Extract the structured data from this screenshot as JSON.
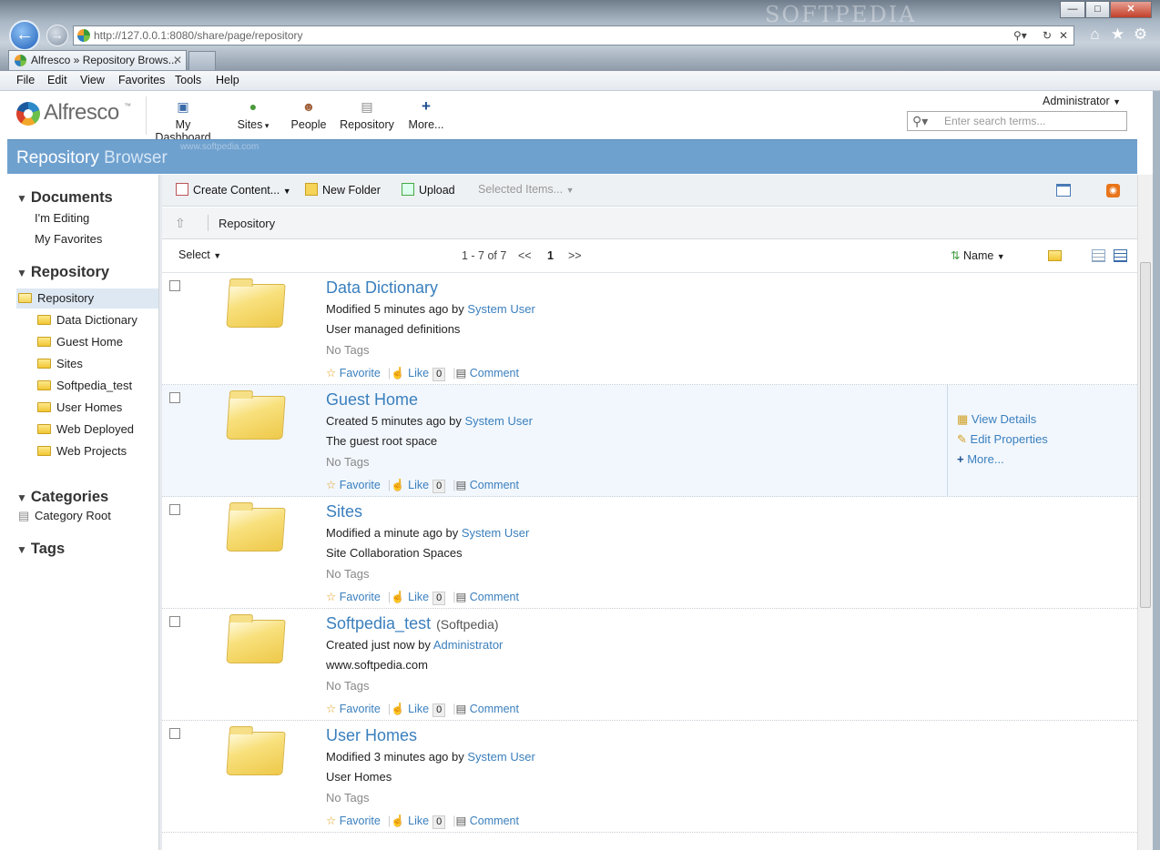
{
  "browser": {
    "watermark": "SOFTPEDIA",
    "address_host": "http://127.0.0.1",
    "address_path": ":8080/share/page/repository",
    "tab_title": "Alfresco » Repository Brows...",
    "menu": [
      "File",
      "Edit",
      "View",
      "Favorites",
      "Tools",
      "Help"
    ]
  },
  "app": {
    "logo": "Alfresco",
    "logo_tm": "™",
    "nav": [
      {
        "label": "My Dashboard",
        "icon": "dashboard-icon"
      },
      {
        "label": "Sites",
        "icon": "globe-icon"
      },
      {
        "label": "People",
        "icon": "people-icon"
      },
      {
        "label": "Repository",
        "icon": "documents-icon"
      },
      {
        "label": "More...",
        "icon": "plus-icon"
      }
    ],
    "user": "Administrator",
    "search_placeholder": "Enter search terms...",
    "page_title_1": "Repository",
    "page_title_2": "Browser",
    "softpedia_small": "www.softpedia.com"
  },
  "sidebar": {
    "documents": {
      "title": "Documents",
      "items": [
        "I'm Editing",
        "My Favorites"
      ]
    },
    "repository": {
      "title": "Repository",
      "root": "Repository",
      "children": [
        "Data Dictionary",
        "Guest Home",
        "Sites",
        "Softpedia_test",
        "User Homes",
        "Web Deployed",
        "Web Projects"
      ]
    },
    "categories": {
      "title": "Categories",
      "root": "Category Root"
    },
    "tags": {
      "title": "Tags"
    }
  },
  "toolbar": {
    "create": "Create Content...",
    "new_folder": "New Folder",
    "upload": "Upload",
    "selected": "Selected Items..."
  },
  "path": "Repository",
  "pager": {
    "select": "Select",
    "range": "1 - 7 of 7",
    "prev": "<<",
    "page": "1",
    "next": ">>",
    "sort": "Name"
  },
  "actions": {
    "favorite": "Favorite",
    "like": "Like",
    "comment": "Comment"
  },
  "rows": [
    {
      "name": "Data Dictionary",
      "extra": "",
      "verb": "Modified 5 minutes ago by",
      "by": "System User",
      "desc": "User managed definitions",
      "tags": "No Tags",
      "likes": "0"
    },
    {
      "name": "Guest Home",
      "extra": "",
      "verb": "Created 5 minutes ago by",
      "by": "System User",
      "desc": "The guest root space",
      "tags": "No Tags",
      "likes": "0"
    },
    {
      "name": "Sites",
      "extra": "",
      "verb": "Modified a minute ago by",
      "by": "System User",
      "desc": "Site Collaboration Spaces",
      "tags": "No Tags",
      "likes": "0"
    },
    {
      "name": "Softpedia_test",
      "extra": "(Softpedia)",
      "verb": "Created just now by",
      "by": "Administrator",
      "desc": "www.softpedia.com",
      "tags": "No Tags",
      "likes": "0"
    },
    {
      "name": "User Homes",
      "extra": "",
      "verb": "Modified 3 minutes ago by",
      "by": "System User",
      "desc": "User Homes",
      "tags": "No Tags",
      "likes": "0"
    }
  ],
  "row_menu": [
    "View Details",
    "Edit Properties",
    "More..."
  ]
}
